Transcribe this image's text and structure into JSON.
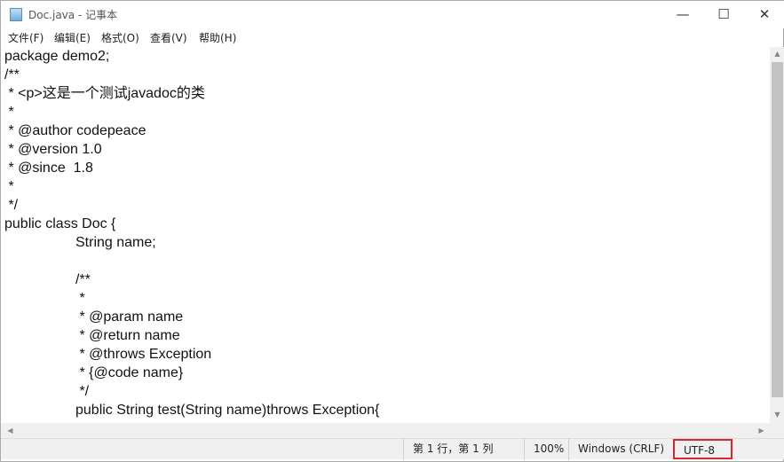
{
  "window": {
    "title": "Doc.java - 记事本",
    "minimize": "—",
    "maximize": "☐",
    "close": "✕"
  },
  "menu": [
    "文件(F)",
    "编辑(E)",
    "格式(O)",
    "查看(V)",
    "帮助(H)"
  ],
  "lines": [
    "package demo2;",
    "/**",
    " * <p>这是一个测试javadoc的类",
    " *",
    " * @author codepeace",
    " * @version 1.0",
    " * @since  1.8",
    " *",
    " */",
    "public class Doc {",
    "\tString name;",
    "",
    "\t/**",
    "\t *",
    "\t * @param name",
    "\t * @return name",
    "\t * @throws Exception",
    "\t * {@code name}",
    "\t */",
    "\tpublic String test(String name)throws Exception{"
  ],
  "status": {
    "position": "第 1 行，第 1 列",
    "zoom": "100%",
    "line_ending": "Windows (CRLF)",
    "encoding": "UTF-8"
  },
  "colors": {
    "highlight": "#d9272e"
  }
}
